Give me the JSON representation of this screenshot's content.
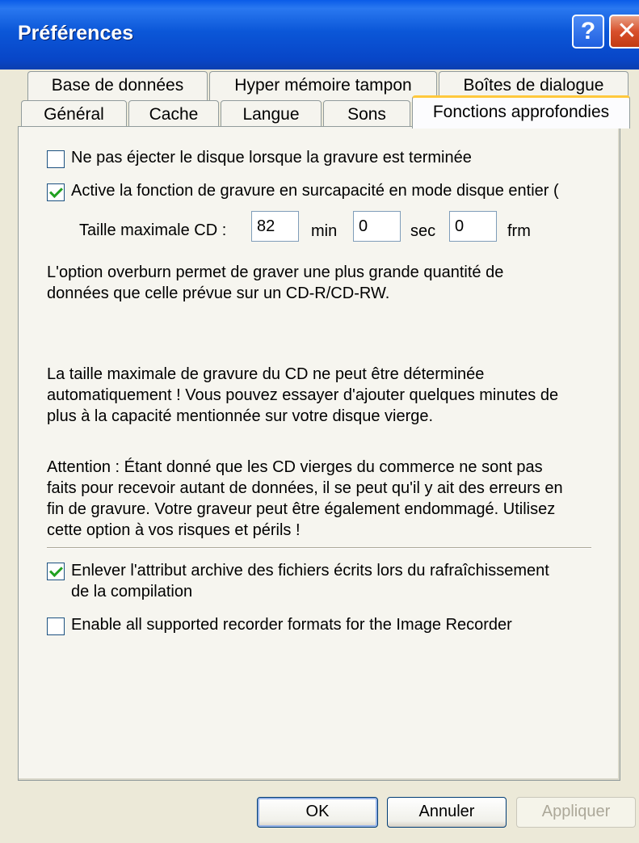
{
  "window": {
    "title": "Préférences",
    "help_glyph": "?",
    "close_glyph": "✕"
  },
  "tabs_row1": [
    "Base de données",
    "Hyper mémoire tampon",
    "Boîtes de dialogue"
  ],
  "tabs_row2": [
    "Général",
    "Cache",
    "Langue",
    "Sons",
    "Fonctions approfondies"
  ],
  "active_tab": "Fonctions approfondies",
  "options": {
    "no_eject": {
      "label": "Ne pas éjecter le disque lorsque la gravure est terminée",
      "checked": false
    },
    "overburn": {
      "label": "Active la fonction de gravure en surcapacité en mode disque entier (",
      "checked": true
    }
  },
  "cd_size": {
    "label": "Taille maximale CD :",
    "min_value": "82",
    "min_unit": "min",
    "sec_value": "0",
    "sec_unit": "sec",
    "frm_value": "0",
    "frm_unit": "frm"
  },
  "info": {
    "overburn_desc": "L'option overburn permet de graver une plus grande quantité de\ndonnées que celle prévue sur un CD-R/CD-RW.",
    "max_size_desc": "La taille maximale de gravure du CD ne peut être déterminée\nautomatiquement ! Vous pouvez essayer d'ajouter quelques minutes de\nplus à la capacité mentionnée sur votre disque vierge.",
    "warning": "Attention : Étant donné que les CD vierges du commerce ne sont pas\nfaits pour recevoir autant de données, il se peut qu'il y ait des erreurs en\nfin de gravure. Votre graveur peut être également endommagé. Utilisez\ncette option à vos risques et périls !"
  },
  "options2": {
    "archive_attr": {
      "label": "Enlever l'attribut archive des fichiers écrits lors du rafraîchissement\nde la compilation",
      "checked": true
    },
    "image_recorder": {
      "label": "Enable all supported recorder formats for the Image Recorder",
      "checked": false
    }
  },
  "buttons": {
    "ok": "OK",
    "cancel": "Annuler",
    "apply": "Appliquer"
  }
}
